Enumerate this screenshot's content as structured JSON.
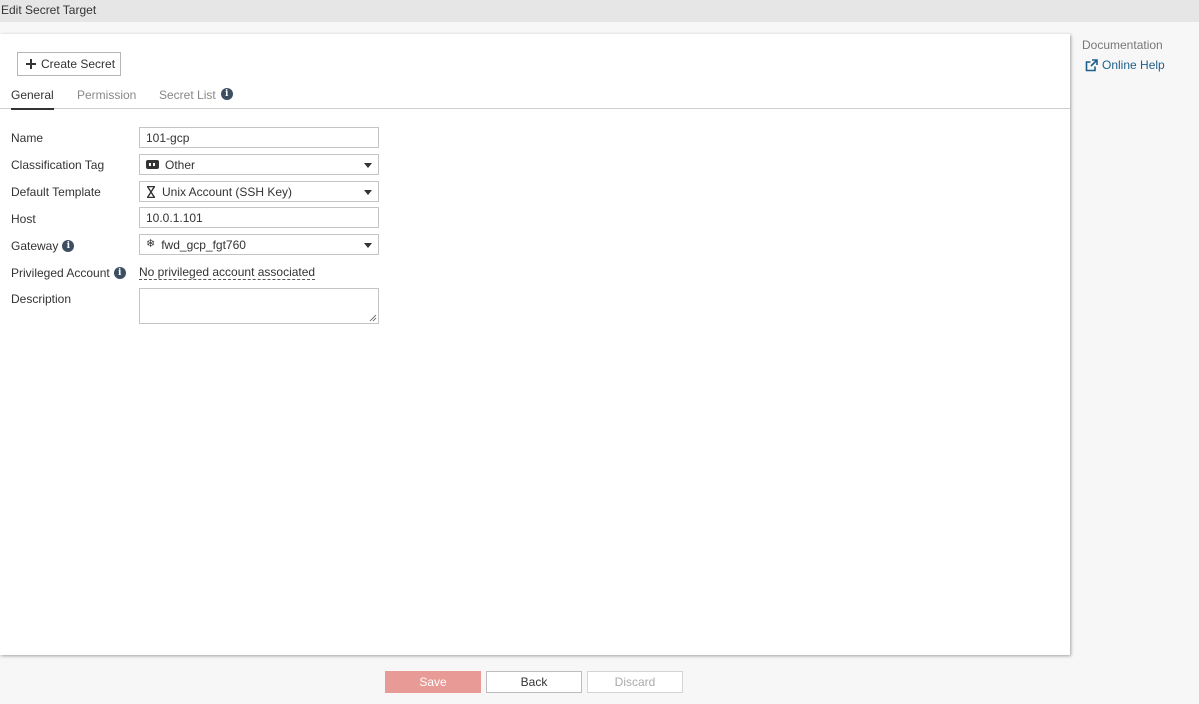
{
  "window": {
    "title": "Edit Secret Target"
  },
  "toolbar": {
    "create_secret_label": "Create Secret"
  },
  "tabs": [
    {
      "label": "General",
      "active": true
    },
    {
      "label": "Permission",
      "active": false
    },
    {
      "label": "Secret List",
      "active": false
    }
  ],
  "form": {
    "name": {
      "label": "Name",
      "value": "101-gcp"
    },
    "classification_tag": {
      "label": "Classification Tag",
      "value": "Other"
    },
    "default_template": {
      "label": "Default Template",
      "value": "Unix Account (SSH Key)"
    },
    "host": {
      "label": "Host",
      "value": "10.0.1.101"
    },
    "gateway": {
      "label": "Gateway",
      "value": "fwd_gcp_fgt760"
    },
    "privileged_account": {
      "label": "Privileged Account",
      "value": "No privileged account associated"
    },
    "description": {
      "label": "Description",
      "value": ""
    }
  },
  "sidebar": {
    "heading": "Documentation",
    "online_help_label": "Online Help"
  },
  "footer": {
    "save_label": "Save",
    "back_label": "Back",
    "discard_label": "Discard"
  },
  "colors": {
    "accent_link": "#1f5f8a",
    "save_disabled": "#e89b96",
    "info_icon": "#3d4e63"
  }
}
